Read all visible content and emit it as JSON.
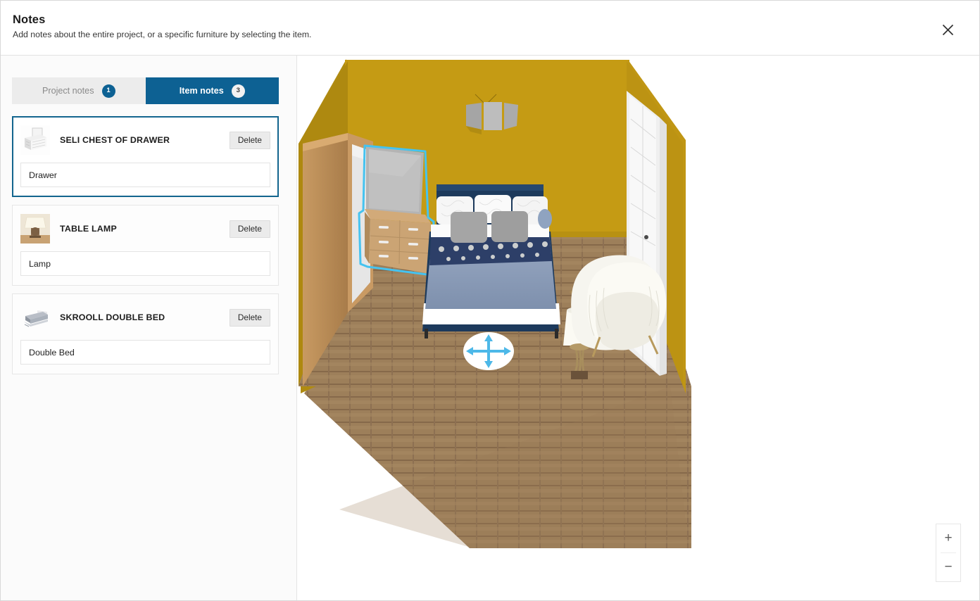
{
  "header": {
    "title": "Notes",
    "subtitle": "Add notes about the entire project, or a specific furniture by selecting the item.",
    "close_icon": "close-icon"
  },
  "tabs": [
    {
      "label": "Project notes",
      "badge": "1",
      "active": false
    },
    {
      "label": "Item notes",
      "badge": "3",
      "active": true
    }
  ],
  "notes": [
    {
      "name": "SELI CHEST OF DRAWER",
      "note": "Drawer",
      "delete_label": "Delete",
      "thumb": "chest-of-drawer-thumbnail",
      "selected": true
    },
    {
      "name": "TABLE LAMP",
      "note": "Lamp",
      "delete_label": "Delete",
      "thumb": "table-lamp-thumbnail",
      "selected": false
    },
    {
      "name": "SKROOLL DOUBLE BED",
      "note": "Double Bed",
      "delete_label": "Delete",
      "thumb": "double-bed-thumbnail",
      "selected": false
    }
  ],
  "viewport": {
    "zoom_in_label": "+",
    "zoom_out_label": "−",
    "move_handle": "move-gizmo",
    "scene_objects": [
      "wardrobe",
      "chest-of-drawers",
      "double-bed",
      "table-lamp",
      "armchair",
      "window",
      "wall-art"
    ]
  },
  "colors": {
    "accent_blue": "#0d6193",
    "selected_border": "#13658e",
    "selection_outline": "#45c3f0",
    "wall": "#c59b14",
    "wall_shadow": "#b08b11",
    "floor": "#9b7c58",
    "bed_frame": "#1d3a5c",
    "panel_bg": "#fbfbfb"
  }
}
